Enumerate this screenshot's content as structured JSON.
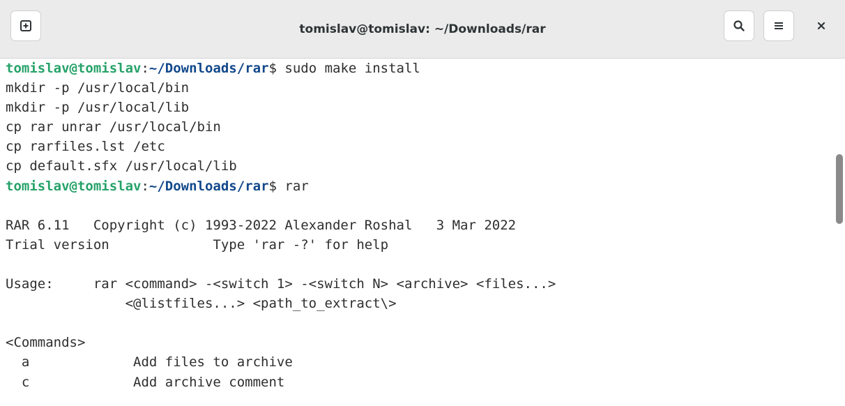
{
  "window": {
    "title": "tomislav@tomislav: ~/Downloads/rar"
  },
  "terminal": {
    "lines": [
      {
        "user": "tomislav@tomislav",
        "sep": ":",
        "path": "~/Downloads/rar",
        "text": "$ sudo make install"
      },
      {
        "text": "mkdir -p /usr/local/bin"
      },
      {
        "text": "mkdir -p /usr/local/lib"
      },
      {
        "text": "cp rar unrar /usr/local/bin"
      },
      {
        "text": "cp rarfiles.lst /etc"
      },
      {
        "text": "cp default.sfx /usr/local/lib"
      },
      {
        "user": "tomislav@tomislav",
        "sep": ":",
        "path": "~/Downloads/rar",
        "text": "$ rar"
      },
      {
        "text": ""
      },
      {
        "text": "RAR 6.11   Copyright (c) 1993-2022 Alexander Roshal   3 Mar 2022"
      },
      {
        "text": "Trial version             Type 'rar -?' for help"
      },
      {
        "text": ""
      },
      {
        "text": "Usage:     rar <command> -<switch 1> -<switch N> <archive> <files...>"
      },
      {
        "text": "               <@listfiles...> <path_to_extract\\>"
      },
      {
        "text": ""
      },
      {
        "text": "<Commands>"
      },
      {
        "text": "  a             Add files to archive"
      },
      {
        "text": "  c             Add archive comment"
      }
    ]
  },
  "scrollbar": {
    "position_fraction": 0.28
  },
  "colors": {
    "prompt_user": "#26a269",
    "prompt_path": "#12488b",
    "text": "#2e2e2e",
    "titlebar_bg": "#ebebeb"
  },
  "icons": {
    "new_tab": "new-tab-icon",
    "search": "search-icon",
    "menu": "hamburger-menu-icon",
    "close": "close-icon"
  }
}
